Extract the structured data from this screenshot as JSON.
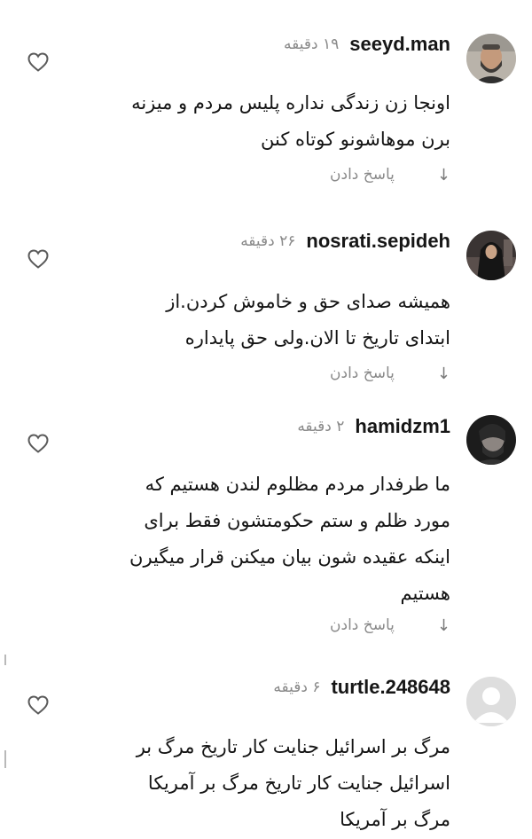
{
  "comments": [
    {
      "username": "seeyd.man",
      "time": "۱۹ دقیقه",
      "text": [
        "اونجا زن زندگی نداره پلیس مردم و میزنه",
        "برن موهاشونو کوتاه کنن"
      ],
      "reply_label": "پاسخ دادن",
      "avatar": "man-with-beard-avatar"
    },
    {
      "username": "nosrati.sepideh",
      "time": "۲۶ دقیقه",
      "text": [
        "همیشه صدای حق و خاموش کردن.از",
        "ابتدای تاریخ تا الان.ولی حق پایداره"
      ],
      "reply_label": "پاسخ دادن",
      "avatar": "woman-in-hijab-avatar"
    },
    {
      "username": "hamidzm1",
      "time": "۲ دقیقه",
      "text": [
        "ما طرفدار مردم مظلوم لندن هستیم که",
        "مورد ظلم و ستم حکومتشون فقط برای",
        "اینکه عقیده شون بیان میکنن قرار میگیرن",
        "هستیم"
      ],
      "reply_label": "پاسخ دادن",
      "avatar": "dark-portrait-avatar"
    },
    {
      "username": "turtle.248648",
      "time": "۶ دقیقه",
      "text": [
        "مرگ بر اسرائیل جنایت کار تاریخ مرگ بر",
        "اسرائیل جنایت کار تاریخ مرگ بر آمریکا",
        "مرگ بر آمریکا"
      ],
      "avatar": "default-user-avatar"
    }
  ],
  "icons": {
    "like": "heart-outline-icon",
    "expand": "down-arrow-icon"
  },
  "colors": {
    "username": "#161616",
    "meta": "#8a8a8a",
    "text": "#141414",
    "background": "#ffffff"
  }
}
